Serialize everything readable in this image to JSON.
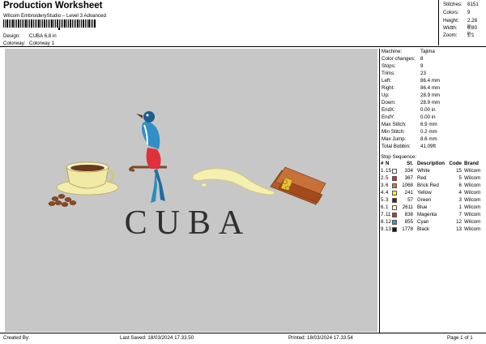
{
  "header": {
    "title": "Production Worksheet",
    "studio": "Wilcom EmbroideryStudio – Level 3 Advanced",
    "barcode_label": "barcode",
    "design_label": "Design:",
    "design_value": "CUBA 6,8 in",
    "colorway_label": "Colorway:",
    "colorway_value": "Colorway 1"
  },
  "stats": [
    {
      "label": "Stitches:",
      "value": "8151"
    },
    {
      "label": "Colors:",
      "value": "9"
    },
    {
      "label": "Height:",
      "value": "2.28 in"
    },
    {
      "label": "Width:",
      "value": "6.80 in"
    },
    {
      "label": "Zoom:",
      "value": "1:1"
    }
  ],
  "design_text": "CUBA",
  "machine_info": [
    {
      "label": "Machine:",
      "value": "Tajima"
    },
    {
      "label": "Color changes:",
      "value": "8"
    },
    {
      "label": "Stops:",
      "value": "9"
    },
    {
      "label": "Trims:",
      "value": "23"
    },
    {
      "label": "Left:",
      "value": "86.4 mm"
    },
    {
      "label": "Right:",
      "value": "86.4 mm"
    },
    {
      "label": "Up:",
      "value": "28.9 mm"
    },
    {
      "label": "Down:",
      "value": "28.9 mm"
    },
    {
      "label": "EndX:",
      "value": "0.00 in"
    },
    {
      "label": "EndY:",
      "value": "0.00 in"
    },
    {
      "label": "Max Stitch:",
      "value": "6.9 mm"
    },
    {
      "label": "Min Stitch:",
      "value": "0.2 mm"
    },
    {
      "label": "Max Jump:",
      "value": "8.6 mm"
    },
    {
      "label": "Total Bobbin:",
      "value": "41.09ft"
    }
  ],
  "sequence": {
    "title": "Stop Sequence:",
    "headers": {
      "num": "#",
      "stop": "N",
      "st": "St.",
      "desc": "Description",
      "code": "Code",
      "brand": "Brand"
    },
    "rows": [
      {
        "num": "1.",
        "stop": "15",
        "color": "#ffffff",
        "st": "334",
        "desc": "White",
        "code": "15",
        "brand": "Wilcom"
      },
      {
        "num": "2.",
        "stop": "5",
        "color": "#e0252c",
        "st": "367",
        "desc": "Red",
        "code": "5",
        "brand": "Wilcom"
      },
      {
        "num": "3.",
        "stop": "6",
        "color": "#c9822d",
        "st": "1068",
        "desc": "Brick Red",
        "code": "6",
        "brand": "Wilcom"
      },
      {
        "num": "4.",
        "stop": "4",
        "color": "#f4ef2b",
        "st": "241",
        "desc": "Yellow",
        "code": "4",
        "brand": "Wilcom"
      },
      {
        "num": "5.",
        "stop": "3",
        "color": "#6b1d12",
        "st": "57",
        "desc": "Green",
        "code": "3",
        "brand": "Wilcom"
      },
      {
        "num": "6.",
        "stop": "1",
        "color": "#fbf6c8",
        "st": "2611",
        "desc": "Blue",
        "code": "1",
        "brand": "Wilcom"
      },
      {
        "num": "7.",
        "stop": "11",
        "color": "#c0391f",
        "st": "838",
        "desc": "Magenta",
        "code": "7",
        "brand": "Wilcom"
      },
      {
        "num": "8.",
        "stop": "12",
        "color": "#2b9bd0",
        "st": "855",
        "desc": "Cyan",
        "code": "12",
        "brand": "Wilcom"
      },
      {
        "num": "9.",
        "stop": "13",
        "color": "#1a1a1a",
        "st": "1778",
        "desc": "Black",
        "code": "13",
        "brand": "Wilcom"
      }
    ]
  },
  "footer": {
    "created": "Created By:",
    "saved": "Last Saved: 18/03/2024 17.33.50",
    "printed": "Printed: 18/03/2024 17.33.54",
    "page": "Page 1 of 1"
  }
}
